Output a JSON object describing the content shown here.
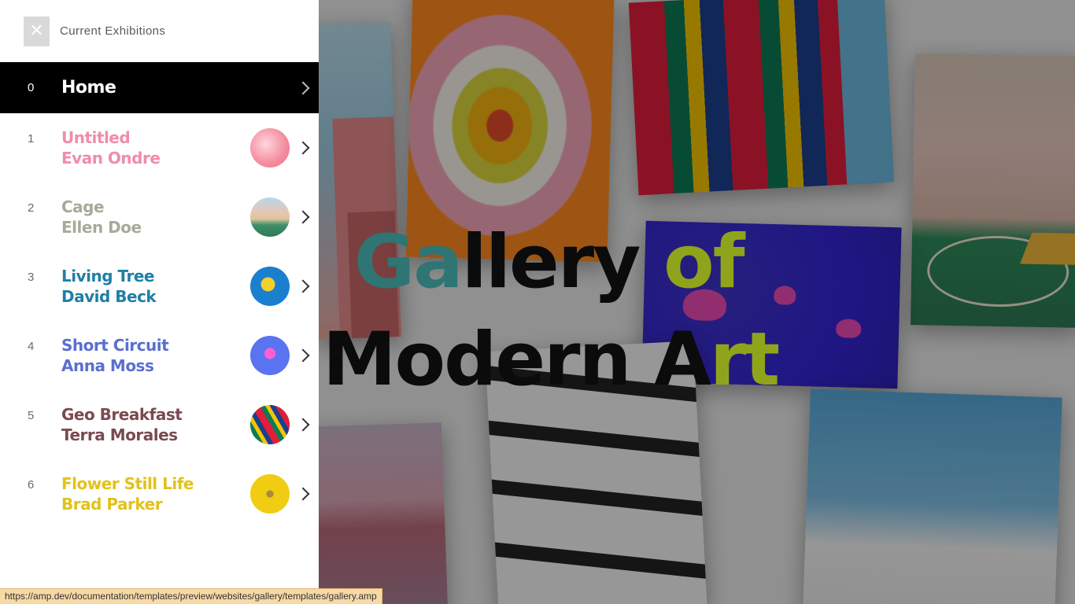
{
  "sidebar": {
    "title": "Current Exhibitions",
    "home": {
      "number": "0",
      "label": "Home"
    },
    "items": [
      {
        "number": "1",
        "title": "Untitled",
        "artist": "Evan Ondre",
        "color": "#f08da8",
        "thumb": "pink-abstract"
      },
      {
        "number": "2",
        "title": "Cage",
        "artist": "Ellen Doe",
        "color": "#a9a99a",
        "thumb": "building-court"
      },
      {
        "number": "3",
        "title": "Living Tree",
        "artist": "David Beck",
        "color": "#1f7fa6",
        "thumb": "blue-yellow-wave"
      },
      {
        "number": "4",
        "title": "Short Circuit",
        "artist": "Anna Moss",
        "color": "#5a6fcf",
        "thumb": "pink-lamp"
      },
      {
        "number": "5",
        "title": "Geo Breakfast",
        "artist": "Terra Morales",
        "color": "#7a4a51",
        "thumb": "hot-air-balloon"
      },
      {
        "number": "6",
        "title": "Flower Still Life",
        "artist": "Brad Parker",
        "color": "#e2c21a",
        "thumb": "yellow-flower"
      }
    ]
  },
  "hero": {
    "line1_a": "Ga",
    "line1_b": "llery ",
    "line1_c": "of",
    "line2_a": "Modern A",
    "line2_b": "rt"
  },
  "status_url": "https://amp.dev/documentation/templates/preview/websites/gallery/templates/gallery.amp"
}
